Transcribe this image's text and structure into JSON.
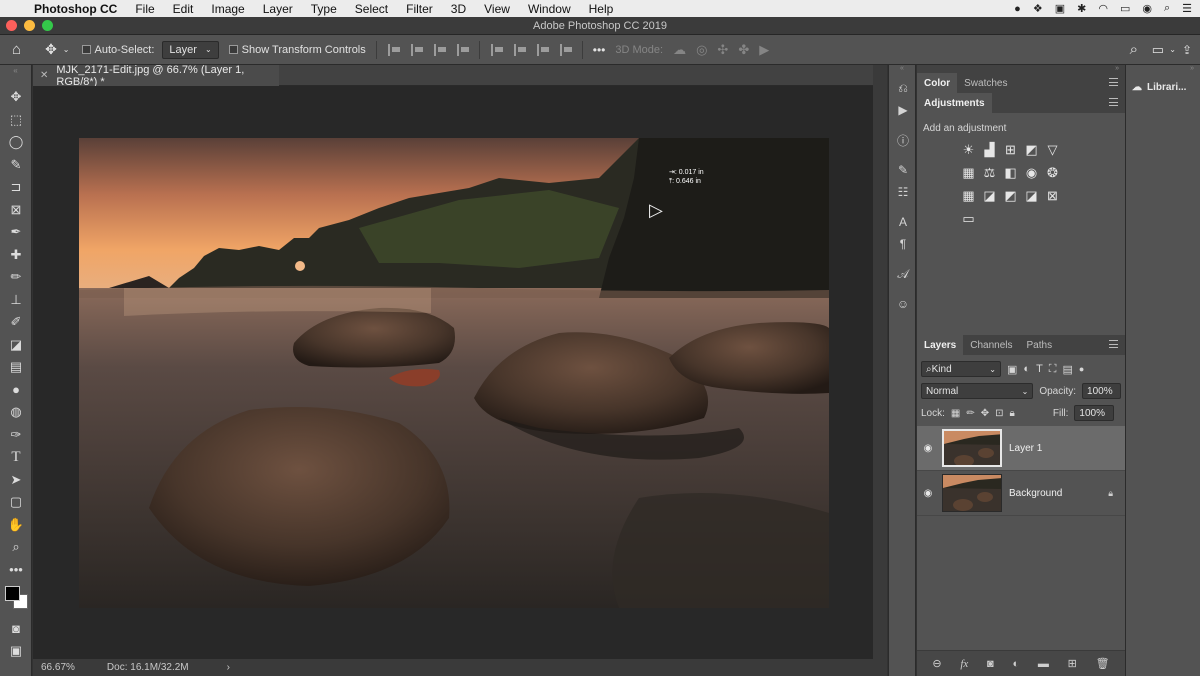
{
  "menubar": {
    "app_name": "Photoshop CC",
    "items": [
      "File",
      "Edit",
      "Image",
      "Layer",
      "Type",
      "Select",
      "Filter",
      "3D",
      "View",
      "Window",
      "Help"
    ]
  },
  "window": {
    "title": "Adobe Photoshop CC 2019"
  },
  "options": {
    "auto_select_label": "Auto-Select:",
    "auto_select_value": "Layer",
    "show_transform_label": "Show Transform Controls",
    "mode_label": "3D Mode:",
    "more": "•••"
  },
  "document": {
    "tab_title": "MJK_2171-Edit.jpg @ 66.7% (Layer 1, RGB/8*) *",
    "measure_x": "0.017 in",
    "measure_y": "0.646 in",
    "x_prefix": "⇥:",
    "y_prefix": "⤒:"
  },
  "status": {
    "zoom": "66.67%",
    "doc": "Doc: 16.1M/32.2M",
    "arrow": "›"
  },
  "color_panel": {
    "tabs": [
      "Color",
      "Swatches"
    ]
  },
  "adjustments": {
    "tab": "Adjustments",
    "hint": "Add an adjustment"
  },
  "layers_panel": {
    "tabs": [
      "Layers",
      "Channels",
      "Paths"
    ],
    "kind_label": "Kind",
    "blend_mode": "Normal",
    "opacity_label": "Opacity:",
    "opacity_value": "100%",
    "lock_label": "Lock:",
    "fill_label": "Fill:",
    "fill_value": "100%",
    "layers": [
      {
        "name": "Layer 1",
        "selected": true,
        "locked": false
      },
      {
        "name": "Background",
        "selected": false,
        "locked": true
      }
    ],
    "footer": [
      "link",
      "fx",
      "mask",
      "adjust",
      "folder",
      "new",
      "trash"
    ]
  },
  "libraries": {
    "label": "Librari..."
  },
  "colors": {
    "accent": "#3a7bd5",
    "panel": "#535353",
    "canvas": "#282828"
  }
}
